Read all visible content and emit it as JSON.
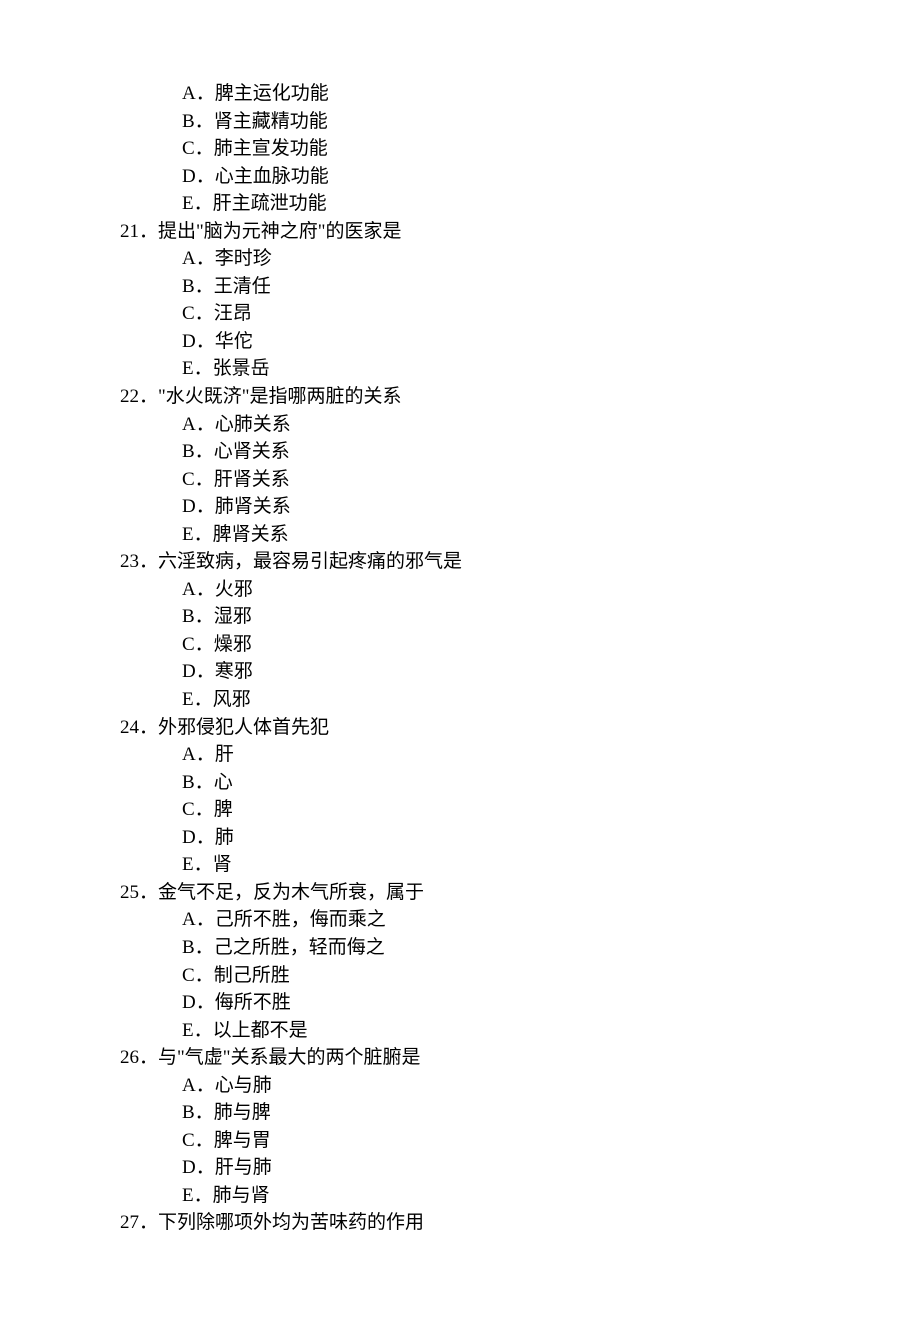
{
  "lead_options": [
    {
      "label": "A．",
      "text": "脾主运化功能"
    },
    {
      "label": "B．",
      "text": "肾主藏精功能"
    },
    {
      "label": "C．",
      "text": "肺主宣发功能"
    },
    {
      "label": "D．",
      "text": "心主血脉功能"
    },
    {
      "label": "E．",
      "text": "肝主疏泄功能"
    }
  ],
  "questions": [
    {
      "num": "21．",
      "stem": "提出\"脑为元神之府\"的医家是",
      "options": [
        {
          "label": "A．",
          "text": "李时珍"
        },
        {
          "label": "B．",
          "text": "王清任"
        },
        {
          "label": "C．",
          "text": "汪昂"
        },
        {
          "label": "D．",
          "text": "华佗"
        },
        {
          "label": "E．",
          "text": "张景岳"
        }
      ]
    },
    {
      "num": "22．",
      "stem": "\"水火既济\"是指哪两脏的关系",
      "options": [
        {
          "label": "A．",
          "text": "心肺关系"
        },
        {
          "label": "B．",
          "text": "心肾关系"
        },
        {
          "label": "C．",
          "text": "肝肾关系"
        },
        {
          "label": "D．",
          "text": "肺肾关系"
        },
        {
          "label": "E．",
          "text": "脾肾关系"
        }
      ]
    },
    {
      "num": "23．",
      "stem": "六淫致病，最容易引起疼痛的邪气是",
      "options": [
        {
          "label": "A．",
          "text": "火邪"
        },
        {
          "label": "B．",
          "text": "湿邪"
        },
        {
          "label": "C．",
          "text": "燥邪"
        },
        {
          "label": "D．",
          "text": "寒邪"
        },
        {
          "label": "E．",
          "text": "风邪"
        }
      ]
    },
    {
      "num": "24．",
      "stem": "外邪侵犯人体首先犯",
      "options": [
        {
          "label": "A．",
          "text": "肝"
        },
        {
          "label": "B．",
          "text": "心"
        },
        {
          "label": "C．",
          "text": "脾"
        },
        {
          "label": "D．",
          "text": "肺"
        },
        {
          "label": "E．",
          "text": "肾"
        }
      ]
    },
    {
      "num": "25．",
      "stem": "金气不足，反为木气所衰，属于",
      "options": [
        {
          "label": "A．",
          "text": "己所不胜，侮而乘之"
        },
        {
          "label": "B．",
          "text": "己之所胜，轻而侮之"
        },
        {
          "label": "C．",
          "text": "制己所胜"
        },
        {
          "label": "D．",
          "text": "侮所不胜"
        },
        {
          "label": "E．",
          "text": "以上都不是"
        }
      ]
    },
    {
      "num": "26．",
      "stem": "与\"气虚\"关系最大的两个脏腑是",
      "options": [
        {
          "label": "A．",
          "text": "心与肺"
        },
        {
          "label": "B．",
          "text": "肺与脾"
        },
        {
          "label": "C．",
          "text": "脾与胃"
        },
        {
          "label": "D．",
          "text": "肝与肺"
        },
        {
          "label": "E．",
          "text": "肺与肾"
        }
      ]
    },
    {
      "num": "27．",
      "stem": "下列除哪项外均为苦味药的作用",
      "options": []
    }
  ]
}
